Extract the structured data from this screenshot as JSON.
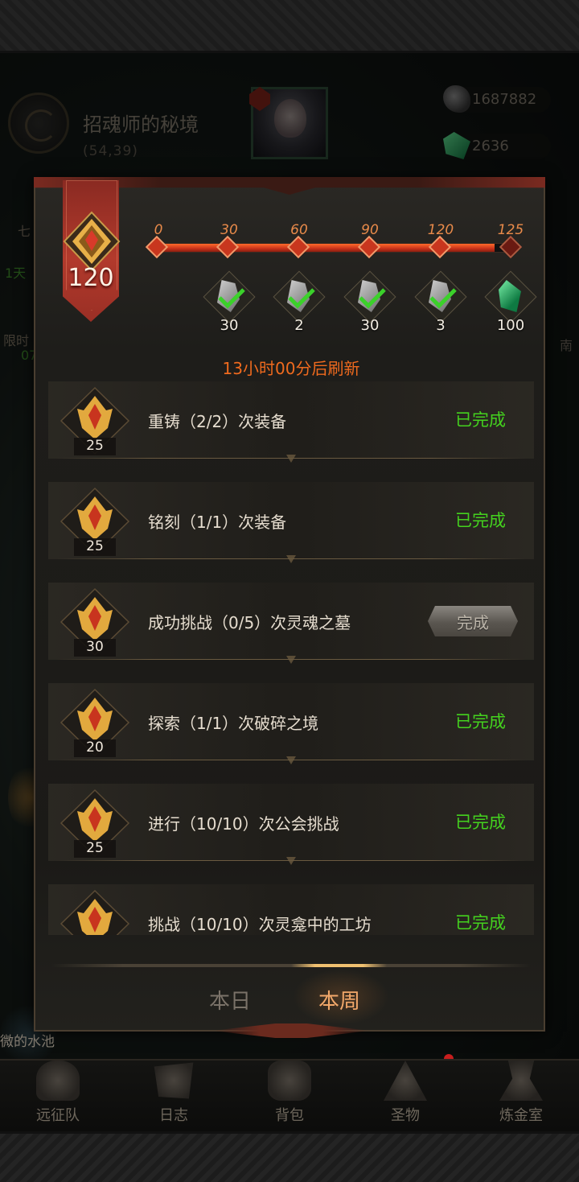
{
  "location": {
    "name": "招魂师的秘境",
    "coords": "(54,39)"
  },
  "currencies": [
    {
      "icon": "stone-currency-icon",
      "value": "1687882"
    },
    {
      "icon": "emerald-currency-icon",
      "value": "2636"
    }
  ],
  "side_left": [
    "七",
    "1天",
    "限时",
    "07"
  ],
  "side_right": [
    "南"
  ],
  "background_label": "微的水池",
  "modal": {
    "level": "120",
    "progress_value": 120,
    "progress_max": 125,
    "milestones": [
      "0",
      "30",
      "60",
      "90",
      "120",
      "125"
    ],
    "rewards": [
      {
        "icon": "stone-icon",
        "qty": "30",
        "claimed": true
      },
      {
        "icon": "stone-icon",
        "qty": "2",
        "claimed": true
      },
      {
        "icon": "stone-icon",
        "qty": "30",
        "claimed": true
      },
      {
        "icon": "stone-icon",
        "qty": "3",
        "claimed": true
      },
      {
        "icon": "emerald-icon",
        "qty": "100",
        "claimed": false
      }
    ],
    "refresh_text": "13小时00分后刷新",
    "tasks": [
      {
        "points": "25",
        "desc": "重铸（2/2）次装备",
        "status": "已完成",
        "done": true
      },
      {
        "points": "25",
        "desc": "铭刻（1/1）次装备",
        "status": "已完成",
        "done": true
      },
      {
        "points": "30",
        "desc": "成功挑战（0/5）次灵魂之墓",
        "status": "完成",
        "done": false
      },
      {
        "points": "20",
        "desc": "探索（1/1）次破碎之境",
        "status": "已完成",
        "done": true
      },
      {
        "points": "25",
        "desc": "进行（10/10）次公会挑战",
        "status": "已完成",
        "done": true
      },
      {
        "points": "",
        "desc": "挑战（10/10）次灵龛中的工坊",
        "status": "已完成",
        "done": true
      }
    ],
    "tabs": {
      "daily": "本日",
      "weekly": "本周",
      "active": "weekly"
    }
  },
  "bottom_nav": [
    {
      "label": "远征队",
      "icon": "helmet-icon"
    },
    {
      "label": "日志",
      "icon": "scroll-icon"
    },
    {
      "label": "背包",
      "icon": "bag-icon"
    },
    {
      "label": "圣物",
      "icon": "relic-icon"
    },
    {
      "label": "炼金室",
      "icon": "alchemy-icon"
    }
  ],
  "colors": {
    "accent_orange": "#ef6a1e",
    "complete_green": "#44d21e",
    "banner_red": "#b23a2c"
  }
}
